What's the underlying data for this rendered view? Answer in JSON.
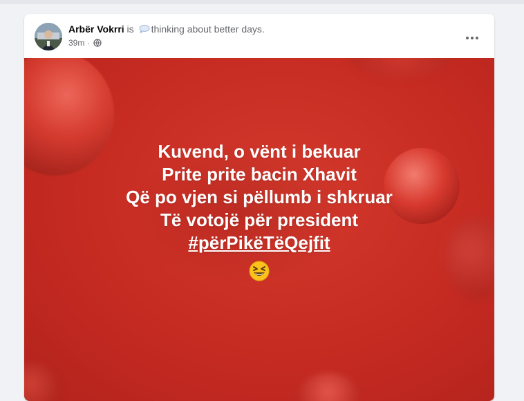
{
  "post": {
    "author": "Arbër Vokrri",
    "is_text": " is ",
    "feeling_icon": "speech-bubble-icon",
    "feeling": "thinking about better days.",
    "time": "39m",
    "separator": " · ",
    "privacy_icon": "globe-icon",
    "more_icon": "more-options-icon",
    "lines": [
      "Kuvend, o vënt i bekuar",
      "Prite prite bacin Xhavit",
      "Që po vjen si pëllumb i shkruar",
      "Të votojë për president"
    ],
    "hashtag": "#përPikëTëQejfit",
    "emoji": "grinning-squinting-face",
    "background_color": "#c62b22"
  }
}
